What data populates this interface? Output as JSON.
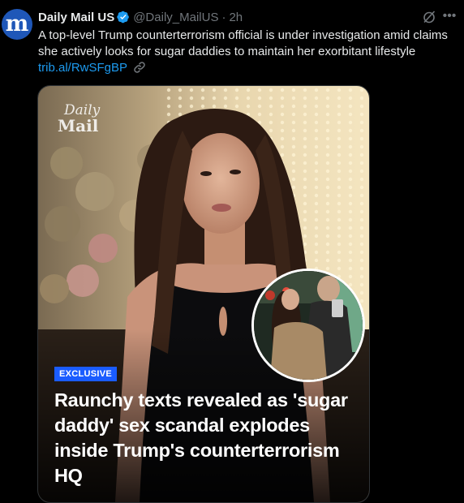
{
  "tweet": {
    "display_name": "Daily Mail US",
    "handle": "@Daily_MailUS",
    "separator": "·",
    "time": "2h",
    "avatar_glyph": "m",
    "text": "A top-level Trump counterterrorism official is under investigation amid claims she actively looks for sugar daddies to maintain her exorbitant lifestyle",
    "link": "trib.al/RwSFgBP",
    "icons": {
      "verified": "verified-badge-icon",
      "link": "link-icon",
      "grok": "grok-icon",
      "more": "more-options-icon"
    },
    "colors": {
      "background": "#000000",
      "text": "#e7e9ea",
      "secondary": "#71767b",
      "link": "#1d9bf0",
      "verified": "#1d9bf0",
      "avatar": "#1f57b8",
      "badge": "#1a5cff"
    }
  },
  "media": {
    "logo_line1": "Daily",
    "logo_line2": "Mail",
    "badge": "EXCLUSIVE",
    "headline": "Raunchy texts revealed as 'sugar daddy' sex scandal explodes inside Trump's counterterrorism HQ"
  }
}
